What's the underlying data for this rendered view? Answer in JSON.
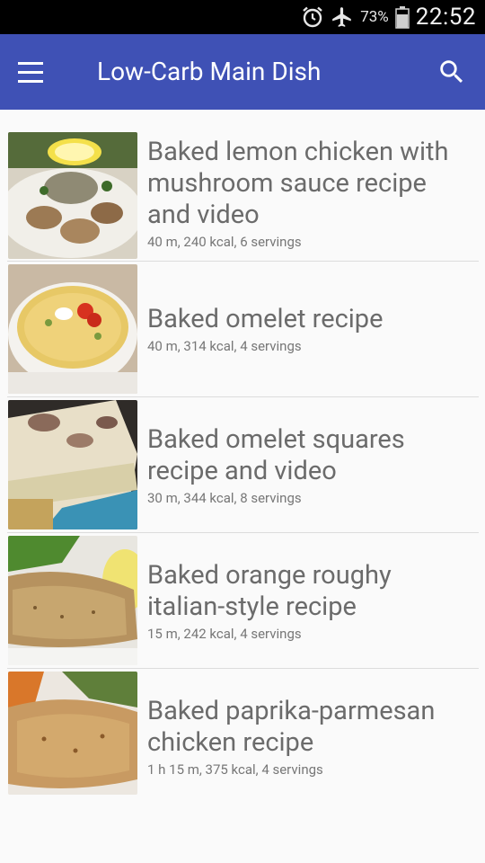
{
  "status": {
    "battery_pct": "73%",
    "time": "22:52",
    "icons": [
      "alarm-icon",
      "airplane-mode-icon",
      "battery-icon"
    ]
  },
  "appbar": {
    "title": "Low-Carb Main Dish",
    "icons": [
      "menu-icon",
      "search-icon"
    ]
  },
  "recipes": [
    {
      "title": "Baked lemon chicken with mushroom sauce recipe and video",
      "meta": "40 m, 240 kcal, 6 servings"
    },
    {
      "title": "Baked omelet recipe",
      "meta": "40 m, 314 kcal, 4 servings"
    },
    {
      "title": "Baked omelet squares recipe and video",
      "meta": "30 m, 344 kcal, 8 servings"
    },
    {
      "title": "Baked orange roughy italian-style recipe",
      "meta": "15 m, 242 kcal, 4 servings"
    },
    {
      "title": "Baked paprika-parmesan chicken recipe",
      "meta": "1 h 15 m, 375 kcal, 4 servings"
    }
  ],
  "colors": {
    "appbar": "#3f51b5",
    "statusbar": "#000000",
    "background": "#fafafa"
  }
}
